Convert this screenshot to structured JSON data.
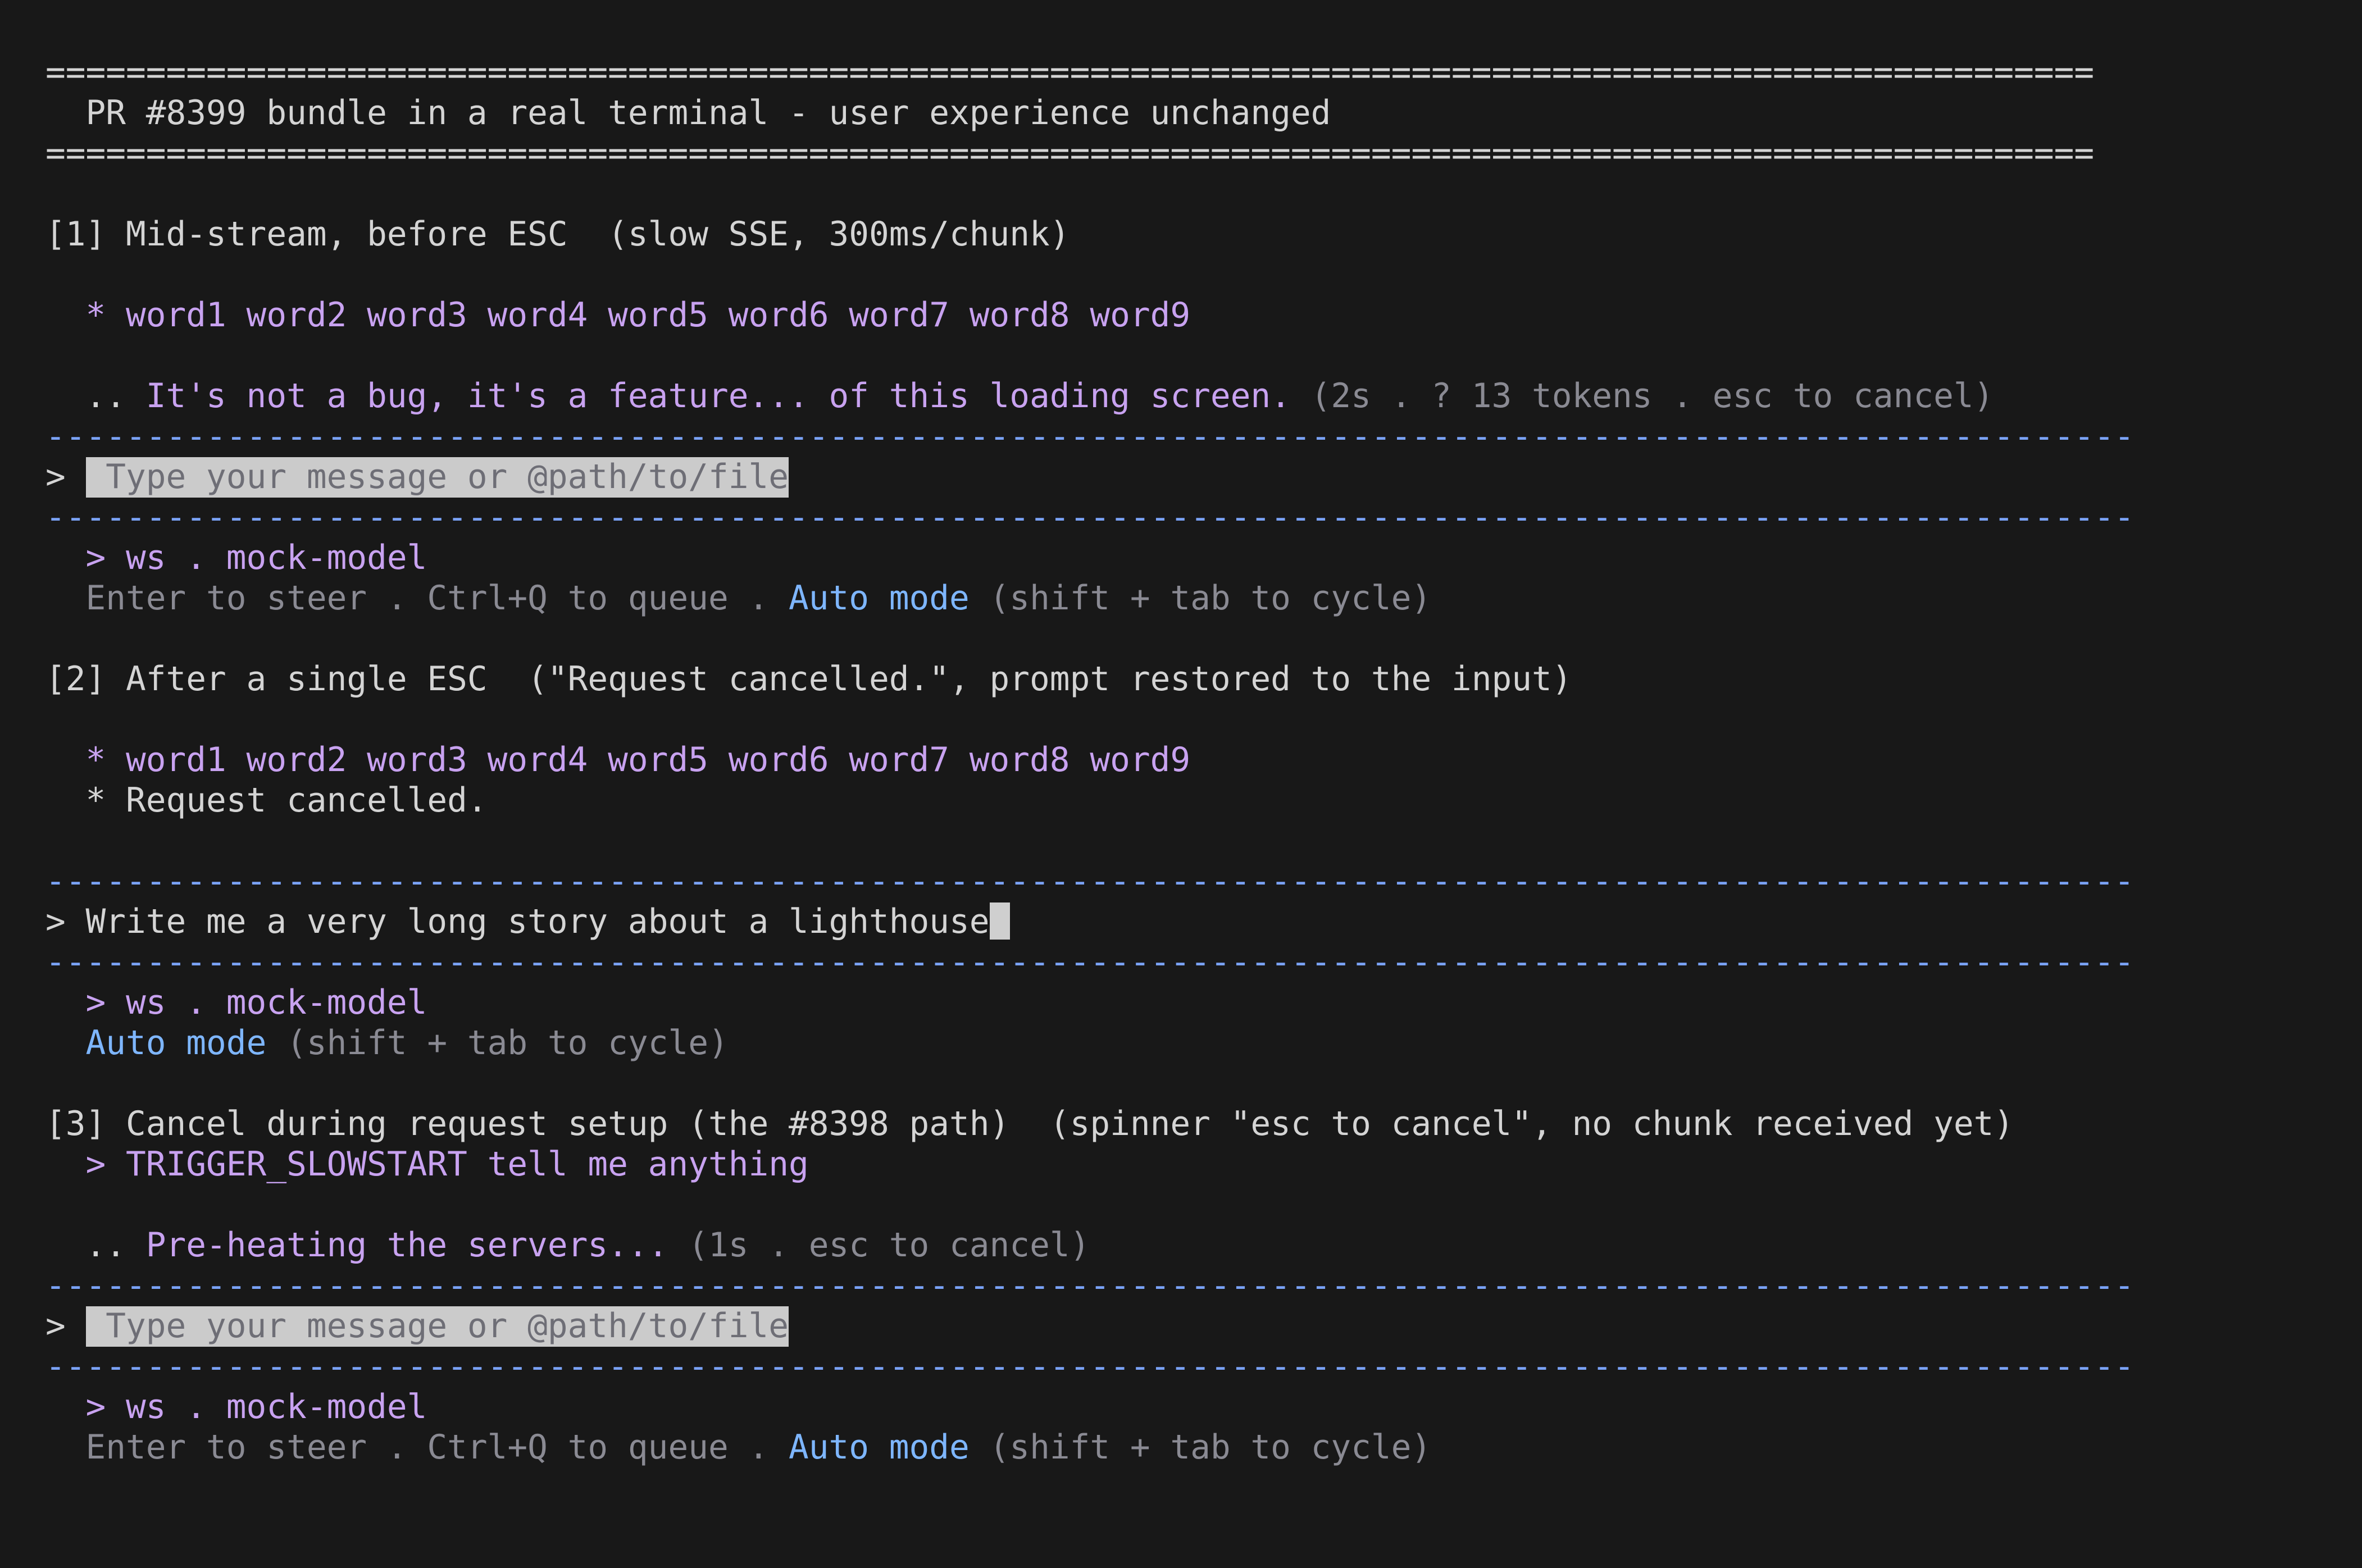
{
  "header": {
    "rule": "======================================================================================================",
    "title": "  PR #8399 bundle in a real terminal - user experience unchanged"
  },
  "hr": "--------------------------------------------------------------------------------------------------------",
  "section1": {
    "heading": "[1] Mid-stream, before ESC  (slow SSE, 300ms/chunk)",
    "stream": "  * word1 word2 word3 word4 word5 word6 word7 word8 word9",
    "spinner_prefix": "  .. ",
    "spinner_text": "It's not a bug, it's a feature... of this loading screen.",
    "spinner_meta": " (2s . ? 13 tokens . esc to cancel)",
    "prompt_symbol": "> ",
    "input_placeholder": " Type your message or @path/to/file",
    "model_line": "  > ws . mock-model",
    "hint_prefix": "  Enter to steer . Ctrl+Q to queue . ",
    "auto_mode": "Auto mode",
    "hint_suffix": " (shift + tab to cycle)"
  },
  "section2": {
    "heading": "[2] After a single ESC  (\"Request cancelled.\", prompt restored to the input)",
    "stream": "  * word1 word2 word3 word4 word5 word6 word7 word8 word9",
    "cancelled": "  * Request cancelled.",
    "prompt_symbol": "> ",
    "input_value": "Write me a very long story about a lighthouse",
    "model_line": "  > ws . mock-model",
    "hint_prefix": "  ",
    "auto_mode": "Auto mode",
    "hint_suffix": " (shift + tab to cycle)"
  },
  "section3": {
    "heading": "[3] Cancel during request setup (the #8398 path)  (spinner \"esc to cancel\", no chunk received yet)",
    "user_prompt": "  > TRIGGER_SLOWSTART tell me anything",
    "spinner_prefix": "  .. ",
    "spinner_text": "Pre-heating the servers...",
    "spinner_meta": " (1s . esc to cancel)",
    "prompt_symbol": "> ",
    "input_placeholder": " Type your message or @path/to/file",
    "model_line": "  > ws . mock-model",
    "hint_prefix": "  Enter to steer . Ctrl+Q to queue . ",
    "auto_mode": "Auto mode",
    "hint_suffix": " (shift + tab to cycle)"
  }
}
